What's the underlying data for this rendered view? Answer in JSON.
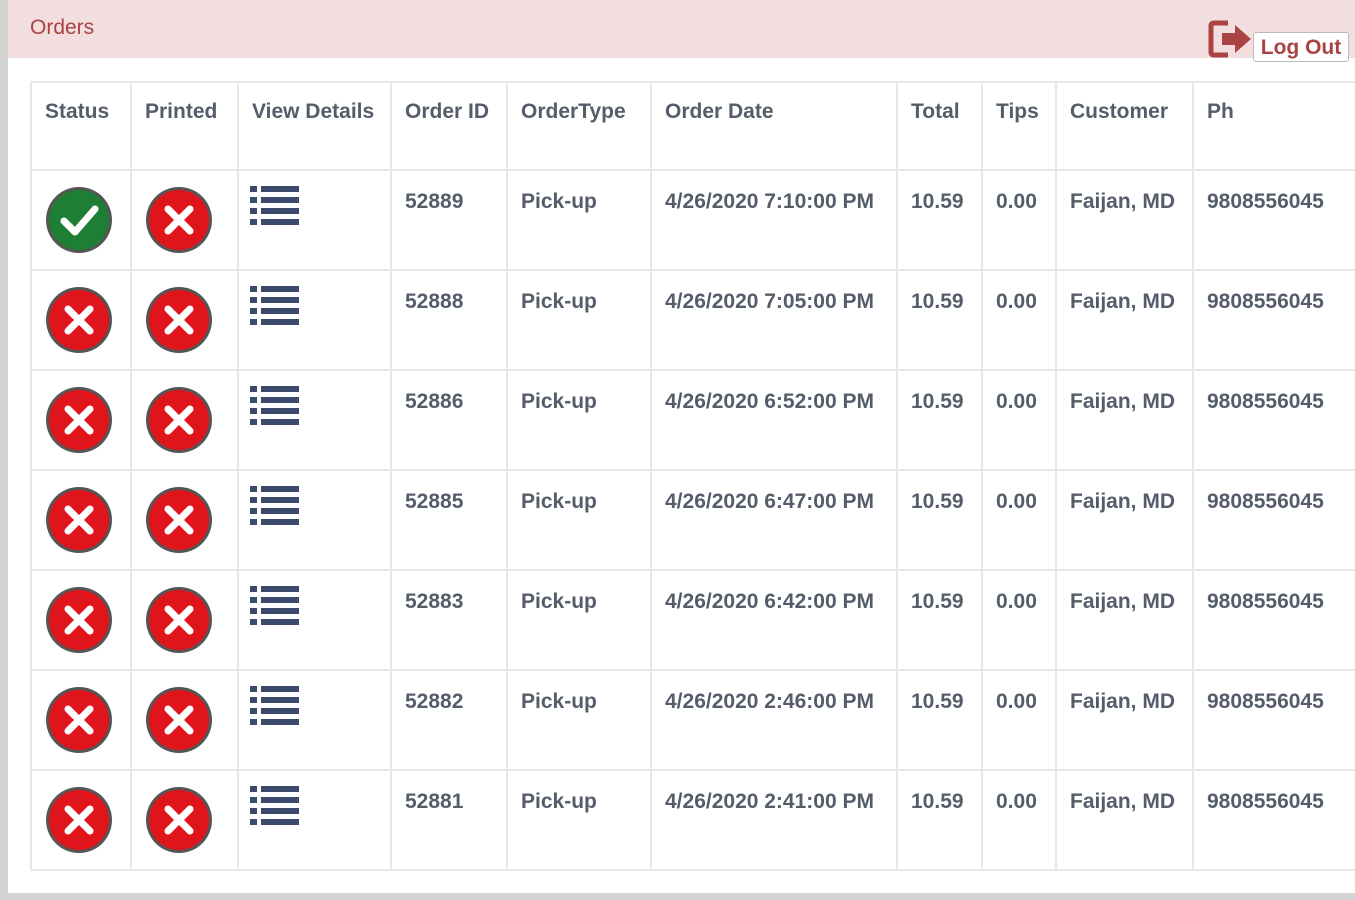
{
  "header": {
    "title": "Orders",
    "logout_label": "Log Out"
  },
  "colors": {
    "header_bg": "#f2dede",
    "title": "#a94442",
    "success": "#1e7e34",
    "danger": "#e0141b"
  },
  "table": {
    "columns": [
      "Status",
      "Printed",
      "View Details",
      "Order ID",
      "OrderType",
      "Order Date",
      "Total",
      "Tips",
      "Customer",
      "Ph"
    ],
    "rows": [
      {
        "status": "check",
        "printed": "x",
        "order_id": "52889",
        "order_type": "Pick-up",
        "order_date": "4/26/2020 7:10:00 PM",
        "total": "10.59",
        "tips": "0.00",
        "customer": "Faijan, MD",
        "phone": "9808556045"
      },
      {
        "status": "x",
        "printed": "x",
        "order_id": "52888",
        "order_type": "Pick-up",
        "order_date": "4/26/2020 7:05:00 PM",
        "total": "10.59",
        "tips": "0.00",
        "customer": "Faijan, MD",
        "phone": "9808556045"
      },
      {
        "status": "x",
        "printed": "x",
        "order_id": "52886",
        "order_type": "Pick-up",
        "order_date": "4/26/2020 6:52:00 PM",
        "total": "10.59",
        "tips": "0.00",
        "customer": "Faijan, MD",
        "phone": "9808556045"
      },
      {
        "status": "x",
        "printed": "x",
        "order_id": "52885",
        "order_type": "Pick-up",
        "order_date": "4/26/2020 6:47:00 PM",
        "total": "10.59",
        "tips": "0.00",
        "customer": "Faijan, MD",
        "phone": "9808556045"
      },
      {
        "status": "x",
        "printed": "x",
        "order_id": "52883",
        "order_type": "Pick-up",
        "order_date": "4/26/2020 6:42:00 PM",
        "total": "10.59",
        "tips": "0.00",
        "customer": "Faijan, MD",
        "phone": "9808556045"
      },
      {
        "status": "x",
        "printed": "x",
        "order_id": "52882",
        "order_type": "Pick-up",
        "order_date": "4/26/2020 2:46:00 PM",
        "total": "10.59",
        "tips": "0.00",
        "customer": "Faijan, MD",
        "phone": "9808556045"
      },
      {
        "status": "x",
        "printed": "x",
        "order_id": "52881",
        "order_type": "Pick-up",
        "order_date": "4/26/2020 2:41:00 PM",
        "total": "10.59",
        "tips": "0.00",
        "customer": "Faijan, MD",
        "phone": "9808556045"
      }
    ]
  }
}
